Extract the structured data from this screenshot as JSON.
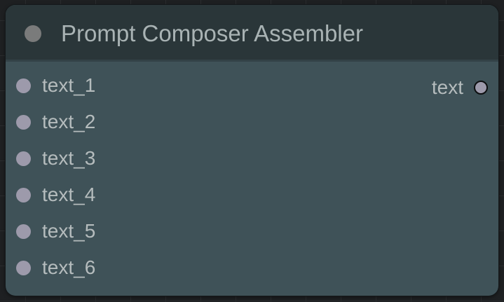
{
  "node": {
    "title": "Prompt Composer Assembler",
    "inputs": [
      {
        "label": "text_1"
      },
      {
        "label": "text_2"
      },
      {
        "label": "text_3"
      },
      {
        "label": "text_4"
      },
      {
        "label": "text_5"
      },
      {
        "label": "text_6"
      }
    ],
    "output": {
      "label": "text"
    }
  },
  "colors": {
    "node_body": "#3f5258",
    "node_header": "#2a3639",
    "slot": "#9d9aab",
    "text": "#b5bcbd"
  }
}
